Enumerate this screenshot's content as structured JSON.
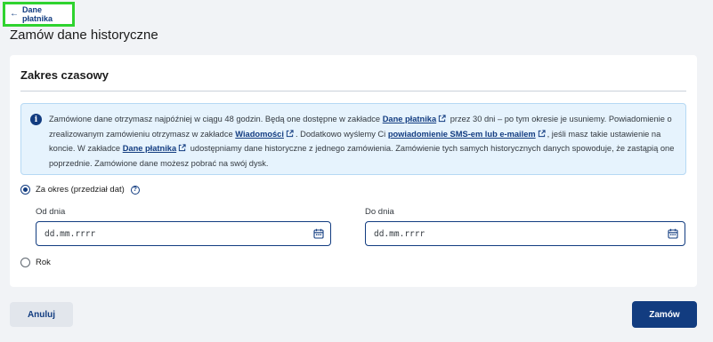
{
  "nav": {
    "back_label": "Dane płatnika"
  },
  "page": {
    "title": "Zamów dane historyczne"
  },
  "card": {
    "title": "Zakres czasowy",
    "info": {
      "t1": "Zamówione dane otrzymasz najpóźniej w ciągu 48 godzin. Będą one dostępne w zakładce ",
      "link1": "Dane płatnika",
      "t2": " przez 30 dni – po tym okresie je usuniemy. Powiadomienie o zrealizowanym zamówieniu otrzymasz w zakładce ",
      "link2": "Wiadomości",
      "t3": ". Dodatkowo wyślemy Ci ",
      "link3": "powiadomienie SMS-em lub e-mailem",
      "t4": ", jeśli masz takie ustawienie na koncie. W zakładce ",
      "link4": "Dane płatnika",
      "t5": " udostępniamy dane historyczne z jednego zamówienia. Zamówienie tych samych historycznych danych spowoduje, że zastąpią one poprzednie. Zamówione dane możesz pobrać na swój dysk."
    },
    "option_period": {
      "label": "Za okres (przedział dat)",
      "selected": true
    },
    "from": {
      "label": "Od dnia",
      "placeholder": "dd.mm.rrrr"
    },
    "to": {
      "label": "Do dnia",
      "placeholder": "dd.mm.rrrr"
    },
    "option_year": {
      "label": "Rok",
      "selected": false
    }
  },
  "actions": {
    "cancel_label": "Anuluj",
    "submit_label": "Zamów"
  },
  "colors": {
    "primary": "#123c80",
    "highlight_border": "#2fd32f",
    "info_bg": "#e6f3fd",
    "page_bg": "#f1f3f6"
  },
  "icons": {
    "back": "arrow-left-icon",
    "info": "info-icon",
    "external": "external-link-icon",
    "help": "help-icon",
    "calendar": "calendar-icon"
  }
}
